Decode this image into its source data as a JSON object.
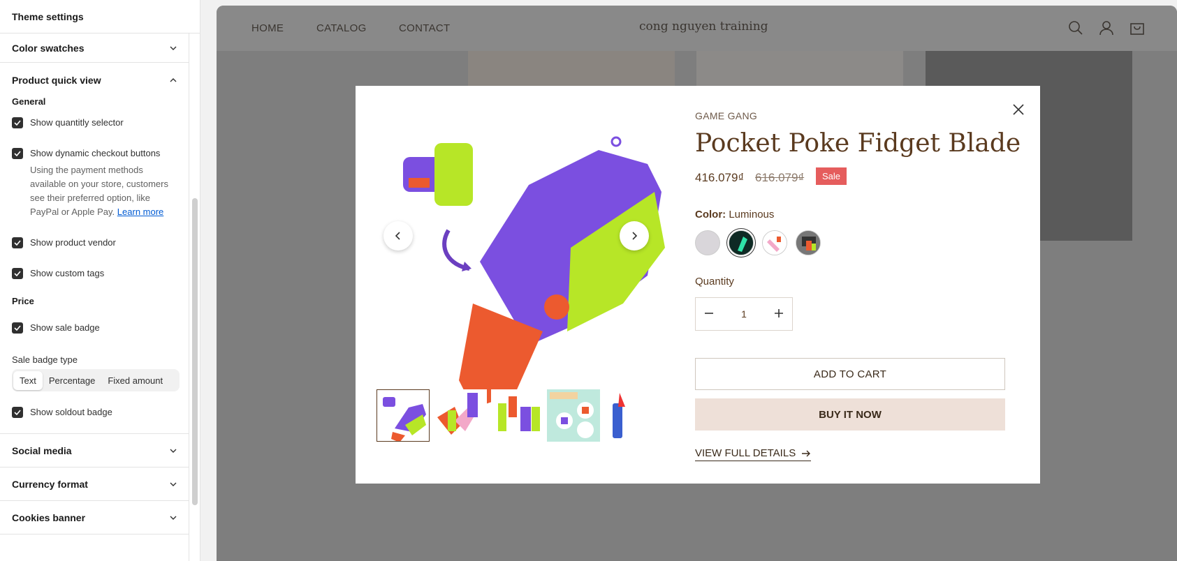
{
  "panel": {
    "title": "Theme settings",
    "sections": {
      "color_swatches": "Color swatches",
      "quick_view": "Product quick view",
      "social_media": "Social media",
      "currency_format": "Currency format",
      "cookies_banner": "Cookies banner"
    },
    "general_label": "General",
    "price_label": "Price",
    "checkboxes": {
      "qty": "Show quantitly selector",
      "dynamic": "Show dynamic checkout buttons",
      "vendor": "Show product vendor",
      "tags": "Show custom tags",
      "sale": "Show sale badge",
      "soldout": "Show soldout badge"
    },
    "dynamic_help": "Using the payment methods available on your store, customers see their preferred option, like PayPal or Apple Pay.",
    "learn_more": "Learn more",
    "sale_badge_type_label": "Sale badge type",
    "sale_badge_options": [
      "Text",
      "Percentage",
      "Fixed amount"
    ],
    "sale_badge_selected": "Text"
  },
  "store": {
    "nav": [
      "HOME",
      "CATALOG",
      "CONTACT"
    ],
    "name": "cong nguyen training"
  },
  "product": {
    "vendor": "GAME GANG",
    "title": "Pocket Poke Fidget Blade",
    "price": "416.079₫",
    "compare_price": "616.079₫",
    "sale_badge": "Sale",
    "color_label": "Color:",
    "color_value": "Luminous",
    "quantity_label": "Quantity",
    "quantity": "1",
    "add_to_cart": "ADD TO CART",
    "buy_now": "BUY IT NOW",
    "view_details": "VIEW FULL DETAILS"
  },
  "colors": {
    "purple": "#7b4fe0",
    "lime": "#b7e627",
    "orange": "#ec5a2f",
    "brand_text": "#5a3a1f",
    "sale_red": "#e55d5d",
    "buy_bg": "#eee0d8"
  }
}
